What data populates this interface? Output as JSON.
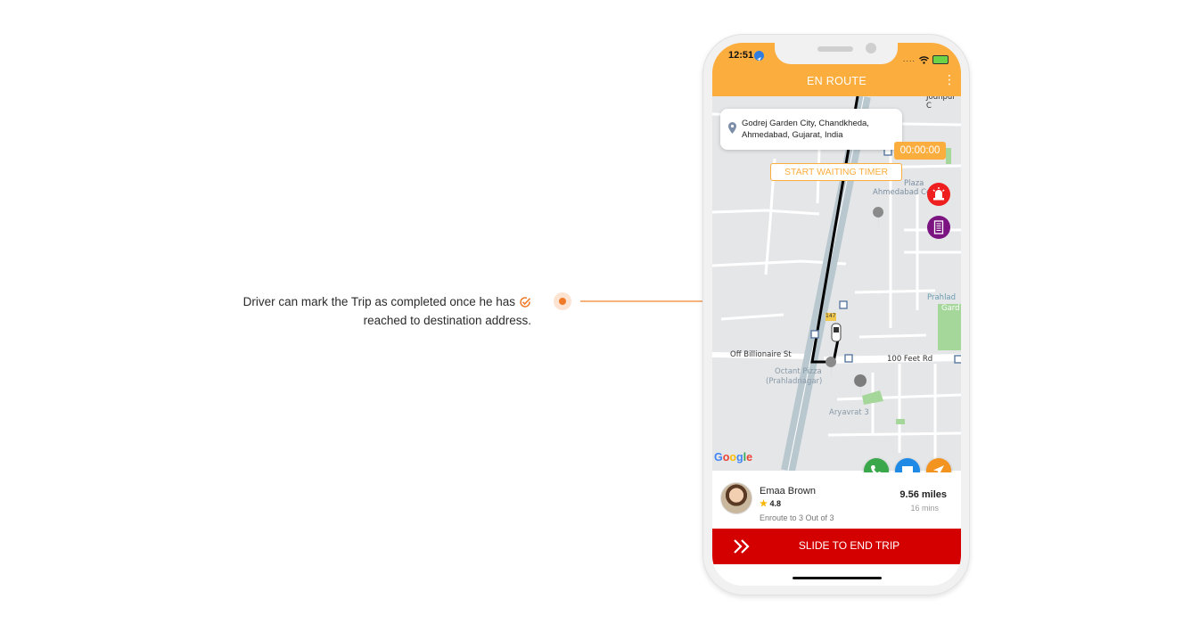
{
  "annotation": {
    "line1": "Driver can mark the Trip as completed once he has",
    "line2": "reached to destination address.",
    "check_icon": "check-circle-icon",
    "accent": "#f07a28"
  },
  "status_bar": {
    "time": "12:51",
    "location_icon": "location-arrow-icon",
    "signal": "....",
    "wifi_icon": "wifi-icon",
    "battery_icon": "battery-charging-icon"
  },
  "header": {
    "title": "EN ROUTE",
    "menu_icon": "more-vertical-icon",
    "color": "#fbad3e"
  },
  "destination": {
    "address": "Godrej Garden City, Chandkheda, Ahmedabad, Gujarat, India",
    "pin_icon": "map-pin-icon"
  },
  "waiting": {
    "timer": "00:00:00",
    "button_label": "START WAITING TIMER"
  },
  "map": {
    "labels": {
      "jodhpur": "Jodhpur C",
      "plaza": "Plaza",
      "ahmedabad": "Ahmedabad Ce",
      "prahlad": "Prahlad",
      "garden": "Gard",
      "off_billionaire": "Off Billionaire St",
      "feet_rd": "100 Feet Rd",
      "octant": "Octant Pizza",
      "prahladnagar": "(Prahladnagar)",
      "aryavrat": "Aryavrat 3",
      "route_shield": "147"
    },
    "attribution": "Google",
    "fabs": [
      {
        "name": "sos",
        "icon": "siren-icon",
        "color": "#f01f1f"
      },
      {
        "name": "bill",
        "icon": "receipt-icon",
        "color": "#7b1480"
      }
    ]
  },
  "actions": [
    {
      "name": "call",
      "icon": "phone-icon",
      "color": "#3aa84a"
    },
    {
      "name": "chat",
      "icon": "chat-icon",
      "color": "#1e8ae6"
    },
    {
      "name": "navigate",
      "icon": "navigation-arrow-icon",
      "color": "#f39320"
    }
  ],
  "rider": {
    "name": "Emaa Brown",
    "rating": "4.8",
    "status": "Enroute to 3 Out of 3",
    "distance": "9.56 miles",
    "duration": "16 mins"
  },
  "slider": {
    "label": "SLIDE TO END TRIP",
    "icon": "double-chevron-right-icon",
    "color": "#d40000"
  }
}
